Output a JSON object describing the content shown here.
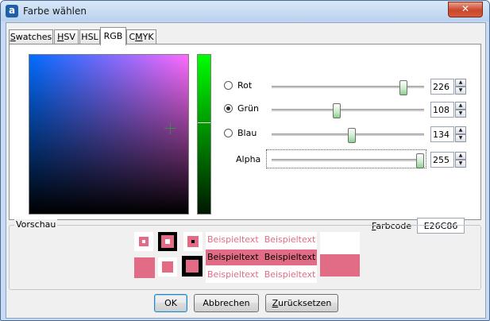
{
  "window": {
    "title": "Farbe wählen",
    "close_glyph": "✕",
    "app_icon_glyph": "a"
  },
  "tabs": [
    {
      "label": "Swatches",
      "mnemonic": "S",
      "rest": "watches"
    },
    {
      "label": "HSV",
      "mnemonic": "H",
      "rest": "SV"
    },
    {
      "label": "HSL",
      "mnemonic": "",
      "rest": "HSL"
    },
    {
      "label": "RGB",
      "mnemonic": "",
      "rest": "RGB"
    },
    {
      "label": "CMYK",
      "pre": "C",
      "mnemonic": "M",
      "rest": "YK"
    }
  ],
  "active_tab": "RGB",
  "channels": [
    {
      "label": "Rot",
      "value": "226",
      "fraction": 0.886,
      "selected": false
    },
    {
      "label": "Grün",
      "value": "108",
      "fraction": 0.424,
      "selected": true
    },
    {
      "label": "Blau",
      "value": "134",
      "fraction": 0.525,
      "selected": false
    },
    {
      "label": "Alpha",
      "value": "255",
      "fraction": 1.0
    }
  ],
  "channel_bar_level": 0.576,
  "farbcode": {
    "label": "Farbcode",
    "mnemonic": "F",
    "rest": "arbcode",
    "value": "E26C86"
  },
  "colors": {
    "selected": "#E26C86",
    "black": "#000000",
    "white": "#FFFFFF"
  },
  "preview": {
    "legend": "Vorschau",
    "sample_text": "Beispieltext",
    "rows": [
      [
        "Beispieltext",
        "Beispieltext"
      ],
      [
        "Beispieltext",
        "Beispieltext"
      ],
      [
        "Beispieltext",
        "Beispieltext"
      ]
    ]
  },
  "buttons": {
    "ok": "OK",
    "cancel": "Abbrechen",
    "reset": "Zurücksetzen",
    "reset_mnemonic": "Z",
    "reset_rest": "urücksetzen"
  }
}
